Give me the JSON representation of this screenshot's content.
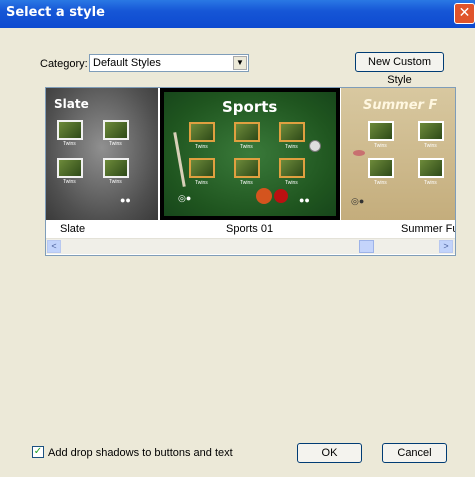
{
  "window": {
    "title": "Select a style",
    "close_glyph": "✕"
  },
  "category": {
    "label": "Category:",
    "value": "Default Styles",
    "dropdown_glyph": "▼"
  },
  "buttons": {
    "new_custom_style": "New Custom Style",
    "ok": "OK",
    "cancel": "Cancel"
  },
  "styles": [
    {
      "caption": "Slate",
      "title": "Slate",
      "thumb_caption": "Twins"
    },
    {
      "caption": "Sports 01",
      "title": "Sports",
      "thumb_caption": "Twins"
    },
    {
      "caption": "Summer Fun",
      "title": "Summer F",
      "thumb_caption": "Twins"
    }
  ],
  "scrollbar": {
    "left_glyph": "<",
    "right_glyph": ">"
  },
  "options": {
    "drop_shadows_label": "Add drop shadows to buttons and text",
    "drop_shadows_checked": true,
    "check_glyph": "✓"
  },
  "colors": {
    "titlebar": "#1656d6",
    "dialog_bg": "#ece9d8",
    "selection_border": "#000000",
    "sports_bg": "#2a6a2a"
  }
}
